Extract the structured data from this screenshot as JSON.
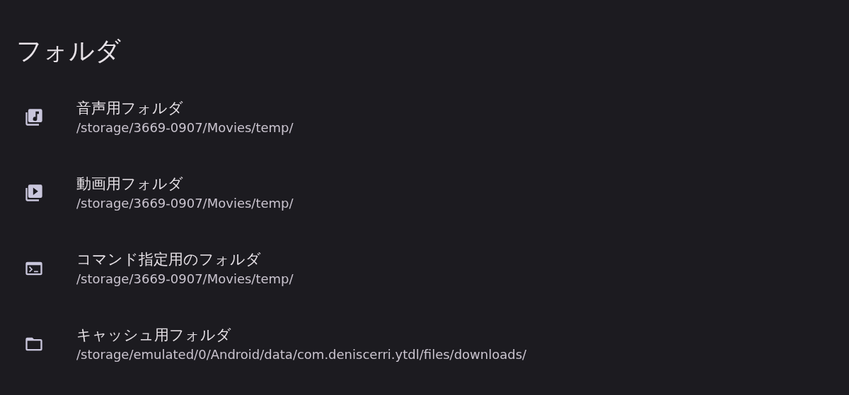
{
  "section_title": "フォルダ",
  "items": [
    {
      "kind": "music",
      "title": "音声用フォルダ",
      "path": "/storage/3669-0907/Movies/temp/"
    },
    {
      "kind": "video",
      "title": "動画用フォルダ",
      "path": "/storage/3669-0907/Movies/temp/"
    },
    {
      "kind": "terminal",
      "title": "コマンド指定用のフォルダ",
      "path": "/storage/3669-0907/Movies/temp/"
    },
    {
      "kind": "folder",
      "title": "キャッシュ用フォルダ",
      "path": "/storage/emulated/0/Android/data/com.deniscerri.ytdl/files/downloads/"
    }
  ]
}
